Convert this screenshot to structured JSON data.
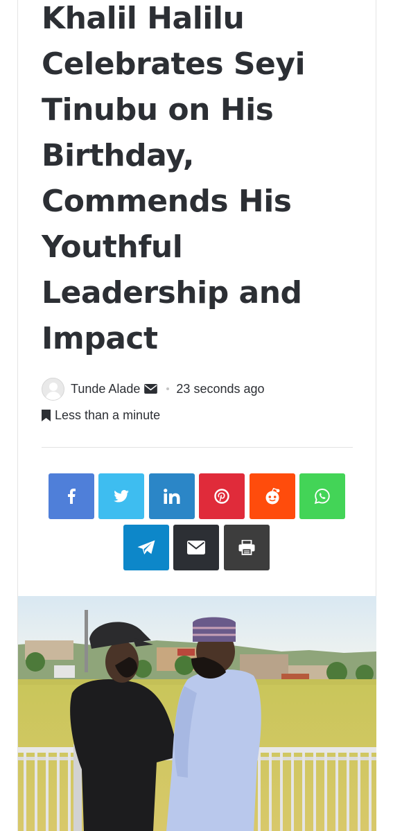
{
  "article": {
    "title": "Khalil Halilu Celebrates Seyi Tinubu on His Birthday, Commends His Youthful Leadership and Impact",
    "author": "Tunde Alade",
    "time_ago": "23 seconds ago",
    "reading_time": "Less than a minute"
  },
  "share_buttons": [
    {
      "name": "facebook",
      "icon": "facebook-icon",
      "color": "#4f7fd9"
    },
    {
      "name": "twitter",
      "icon": "twitter-icon",
      "color": "#3ebdf0"
    },
    {
      "name": "linkedin",
      "icon": "linkedin-icon",
      "color": "#2b86c7"
    },
    {
      "name": "pinterest",
      "icon": "pinterest-icon",
      "color": "#e02b3a"
    },
    {
      "name": "reddit",
      "icon": "reddit-icon",
      "color": "#ff4c0c"
    },
    {
      "name": "whatsapp",
      "icon": "whatsapp-icon",
      "color": "#43d457"
    },
    {
      "name": "telegram",
      "icon": "telegram-icon",
      "color": "#0d87c9"
    },
    {
      "name": "email",
      "icon": "envelope-icon",
      "color": "#2c2f34"
    },
    {
      "name": "print",
      "icon": "printer-icon",
      "color": "#3d3d3d"
    }
  ],
  "colors": {
    "text": "#2c2f34",
    "divider": "#e2e2e2"
  }
}
